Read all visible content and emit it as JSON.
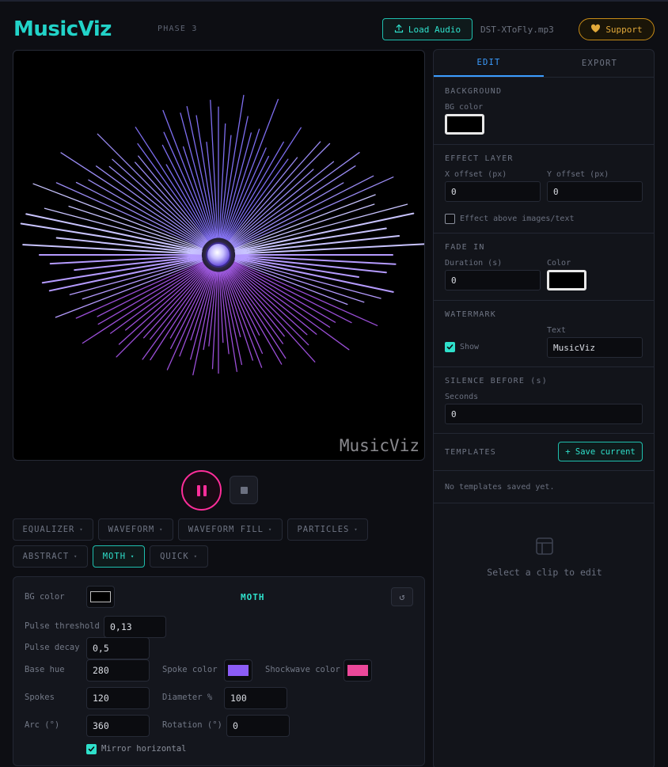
{
  "header": {
    "logo": "MusicViz",
    "phase": "PHASE 3",
    "load_audio": "Load Audio",
    "filename": "DST-XToFly.mp3",
    "support": "Support"
  },
  "preview": {
    "watermark": "MusicViz",
    "spoke_count": 120,
    "spoke_color": "#8b5cf6",
    "accent_colors": {
      "teal": "#2fe0cb",
      "pink": "#ff2e9a",
      "blue": "#3b9cff",
      "gold": "#e2a93a"
    }
  },
  "transport": {
    "pause_icon": "pause-icon",
    "stop_icon": "stop-icon"
  },
  "effects": {
    "row1": [
      "EQUALIZER",
      "WAVEFORM",
      "WAVEFORM FILL",
      "PARTICLES"
    ],
    "row2": [
      "ABSTRACT",
      "MOTH",
      "QUICK"
    ],
    "active": "MOTH"
  },
  "moth": {
    "title": "MOTH",
    "bg_color_label": "BG color",
    "bg_color": "#000000",
    "pulse_threshold_label": "Pulse threshold",
    "pulse_threshold": "0,13",
    "pulse_decay_label": "Pulse decay",
    "pulse_decay": "0,5",
    "base_hue_label": "Base hue",
    "base_hue": "280",
    "spoke_color_label": "Spoke color",
    "spoke_color": "#8b5cf6",
    "shockwave_color_label": "Shockwave color",
    "shockwave_color": "#ec4899",
    "spokes_label": "Spokes",
    "spokes": "120",
    "diameter_label": "Diameter %",
    "diameter": "100",
    "arc_label": "Arc (°)",
    "arc": "360",
    "rotation_label": "Rotation (°)",
    "rotation": "0",
    "mirror_label": "Mirror horizontal",
    "mirror_checked": true
  },
  "panel": {
    "tabs": [
      "EDIT",
      "EXPORT"
    ],
    "background_h": "BACKGROUND",
    "bg_color_label": "BG color",
    "effect_layer_h": "EFFECT LAYER",
    "x_offset_label": "X offset (px)",
    "x_offset": "0",
    "y_offset_label": "Y offset (px)",
    "y_offset": "0",
    "effect_above_label": "Effect above images/text",
    "fade_in_h": "FADE IN",
    "duration_label": "Duration (s)",
    "duration": "0",
    "color_label": "Color",
    "watermark_h": "WATERMARK",
    "text_label": "Text",
    "show_label": "Show",
    "watermark_text": "MusicViz",
    "silence_h": "SILENCE BEFORE (s)",
    "seconds_label": "Seconds",
    "seconds": "0",
    "templates_h": "TEMPLATES",
    "save_current": "+ Save current",
    "no_templates": "No templates saved yet.",
    "select_clip": "Select a clip to edit"
  }
}
